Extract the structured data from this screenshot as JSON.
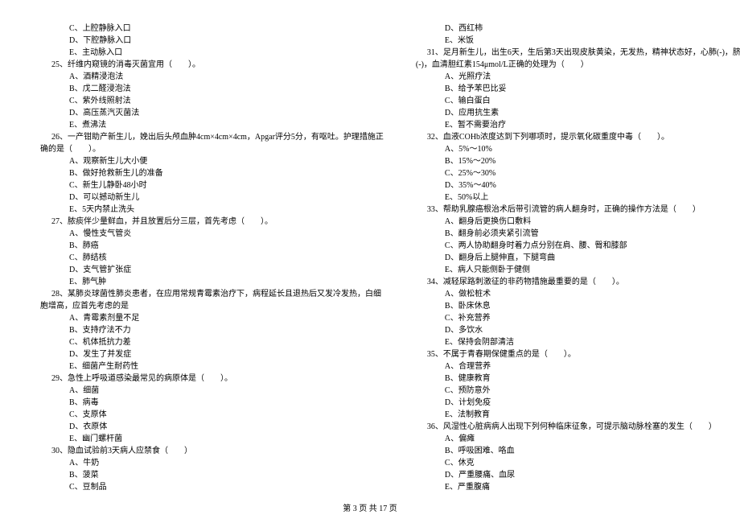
{
  "left": [
    {
      "cls": "opt",
      "text": "C、上腔静脉入口"
    },
    {
      "cls": "opt",
      "text": "D、下腔静脉入口"
    },
    {
      "cls": "opt",
      "text": "E、主动脉入口"
    },
    {
      "cls": "q",
      "text": "25、纤维内窥镜的消毒灭菌宜用（　　）。"
    },
    {
      "cls": "opt",
      "text": "A、酒精浸泡法"
    },
    {
      "cls": "opt",
      "text": "B、戊二醛浸泡法"
    },
    {
      "cls": "opt",
      "text": "C、紫外线照射法"
    },
    {
      "cls": "opt",
      "text": "D、高压蒸汽灭菌法"
    },
    {
      "cls": "opt",
      "text": "E、煮沸法"
    },
    {
      "cls": "q",
      "text": "26、一产钳助产新生儿，娩出后头颅血肿4cm×4cm×4cm，Apgar评分5分，有呕吐。护理措施正"
    },
    {
      "cls": "q-cont",
      "text": "确的是（　　）。"
    },
    {
      "cls": "opt",
      "text": "A、观察新生儿大小便"
    },
    {
      "cls": "opt",
      "text": "B、做好抢救新生儿的准备"
    },
    {
      "cls": "opt",
      "text": "C、新生儿静卧48小时"
    },
    {
      "cls": "opt",
      "text": "D、可以撼动新生儿"
    },
    {
      "cls": "opt",
      "text": "E、5天内禁止洗头"
    },
    {
      "cls": "q",
      "text": "27、脓痰伴少量鲜血，并且放置后分三层，首先考虑（　　）。"
    },
    {
      "cls": "opt",
      "text": "A、慢性支气管炎"
    },
    {
      "cls": "opt",
      "text": "B、肺癌"
    },
    {
      "cls": "opt",
      "text": "C、肺结核"
    },
    {
      "cls": "opt",
      "text": "D、支气管扩张症"
    },
    {
      "cls": "opt",
      "text": "E、肺气肿"
    },
    {
      "cls": "q",
      "text": "28、某肺炎球菌性肺炎患者，在应用常规青霉素治疗下，病程延长且退热后又发冷发热，白细"
    },
    {
      "cls": "q-cont",
      "text": "胞增高，应首先考虑的是"
    },
    {
      "cls": "opt",
      "text": "A、青霉素剂量不足"
    },
    {
      "cls": "opt",
      "text": "B、支持疗法不力"
    },
    {
      "cls": "opt",
      "text": "C、机体抵抗力差"
    },
    {
      "cls": "opt",
      "text": "D、发生了并发症"
    },
    {
      "cls": "opt",
      "text": "E、细菌产生耐药性"
    },
    {
      "cls": "q",
      "text": "29、急性上呼吸道感染最常见的病原体是（　　）。"
    },
    {
      "cls": "opt",
      "text": "A、细菌"
    },
    {
      "cls": "opt",
      "text": "B、病毒"
    },
    {
      "cls": "opt",
      "text": "C、支原体"
    },
    {
      "cls": "opt",
      "text": "D、衣原体"
    },
    {
      "cls": "opt",
      "text": "E、幽门螺杆菌"
    },
    {
      "cls": "q",
      "text": "30、隐血试验前3天病人应禁食（　　）"
    },
    {
      "cls": "opt",
      "text": "A、牛奶"
    },
    {
      "cls": "opt",
      "text": "B、菠菜"
    },
    {
      "cls": "opt",
      "text": "C、豆制品"
    }
  ],
  "right": [
    {
      "cls": "opt",
      "text": "D、西红柿"
    },
    {
      "cls": "opt",
      "text": "E、米饭"
    },
    {
      "cls": "q",
      "text": "31、足月新生儿，出生6天，生后第3天出现皮肤黄染，无发热，精神状态好，心肺(-)，脐"
    },
    {
      "cls": "q-cont",
      "text": "(-)，血清胆红素154μmol/L正确的处理为（　　）"
    },
    {
      "cls": "opt",
      "text": "A、光照疗法"
    },
    {
      "cls": "opt",
      "text": "B、给予苯巴比妥"
    },
    {
      "cls": "opt",
      "text": "C、输白蛋白"
    },
    {
      "cls": "opt",
      "text": "D、应用抗生素"
    },
    {
      "cls": "opt",
      "text": "E、暂不需要治疗"
    },
    {
      "cls": "q",
      "text": "32、血液COHb浓度达到下列哪项时，提示氧化碳重度中毒（　　）。"
    },
    {
      "cls": "opt",
      "text": "A、5%～10%"
    },
    {
      "cls": "opt",
      "text": "B、15%～20%"
    },
    {
      "cls": "opt",
      "text": "C、25%～30%"
    },
    {
      "cls": "opt",
      "text": "D、35%～40%"
    },
    {
      "cls": "opt",
      "text": "E、50%以上"
    },
    {
      "cls": "q",
      "text": "33、帮助乳腺癌根治术后带引流管的病人翻身时，正确的操作方法是（　　）"
    },
    {
      "cls": "opt",
      "text": "A、翻身后更换伤口敷料"
    },
    {
      "cls": "opt",
      "text": "B、翻身前必须夹紧引流管"
    },
    {
      "cls": "opt",
      "text": "C、两人协助翻身时着力点分别在肩、腰、臀和膝部"
    },
    {
      "cls": "opt",
      "text": "D、翻身后上腿伸直，下腿弯曲"
    },
    {
      "cls": "opt",
      "text": "E、病人只能侧卧于健侧"
    },
    {
      "cls": "q",
      "text": "34、减轻尿路刺激征的非药物措施最重要的是（　　）。"
    },
    {
      "cls": "opt",
      "text": "A、做松桩术"
    },
    {
      "cls": "opt",
      "text": "B、卧床休息"
    },
    {
      "cls": "opt",
      "text": "C、补充营养"
    },
    {
      "cls": "opt",
      "text": "D、多饮水"
    },
    {
      "cls": "opt",
      "text": "E、保持会阴部清洁"
    },
    {
      "cls": "q",
      "text": "35、不属于青春期保健重点的是（　　）。"
    },
    {
      "cls": "opt",
      "text": "A、合理营养"
    },
    {
      "cls": "opt",
      "text": "B、健康教育"
    },
    {
      "cls": "opt",
      "text": "C、预防意外"
    },
    {
      "cls": "opt",
      "text": "D、计划免疫"
    },
    {
      "cls": "opt",
      "text": "E、法制教育"
    },
    {
      "cls": "q",
      "text": "36、风湿性心脏病病人出现下列何种临床征象，可提示脑动脉栓塞的发生（　　）"
    },
    {
      "cls": "opt",
      "text": "A、偏瘫"
    },
    {
      "cls": "opt",
      "text": "B、呼吸困难、咯血"
    },
    {
      "cls": "opt",
      "text": "C、休克"
    },
    {
      "cls": "opt",
      "text": "D、严重腰痛、血尿"
    },
    {
      "cls": "opt",
      "text": "E、严重腹痛"
    }
  ],
  "footer": "第 3 页 共 17 页"
}
